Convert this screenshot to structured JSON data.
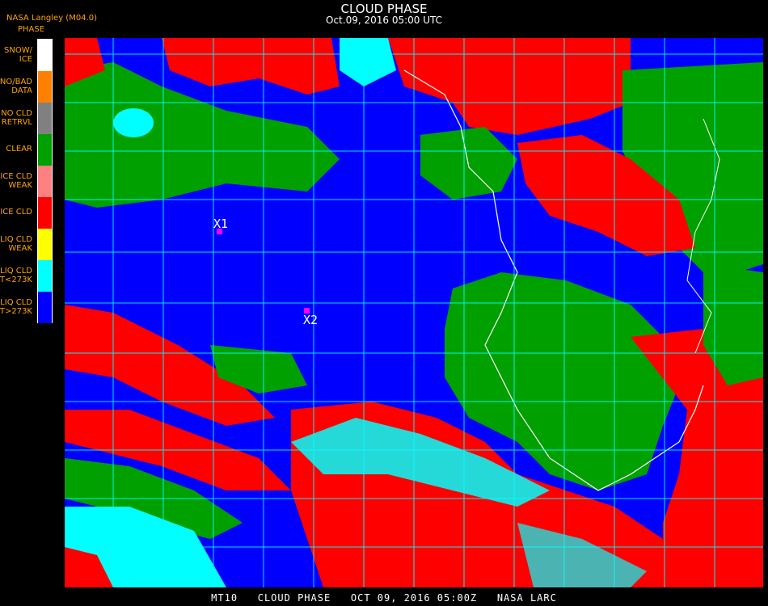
{
  "header": {
    "title": "CLOUD PHASE",
    "subtitle": "Oct.09, 2016 05:00 UTC",
    "provider": "NASA Langley (M04.0)"
  },
  "legend": {
    "title": "PHASE",
    "items": [
      {
        "label": "SNOW/\nICE",
        "color": "#ffffff"
      },
      {
        "label": "NO/BAD\nDATA",
        "color": "#ff8000"
      },
      {
        "label": "NO CLD\nRETRVL",
        "color": "#808080"
      },
      {
        "label": "CLEAR",
        "color": "#00a000"
      },
      {
        "label": "ICE CLD\nWEAK",
        "color": "#ff8080"
      },
      {
        "label": "ICE CLD",
        "color": "#ff0000"
      },
      {
        "label": "LIQ CLD\nWEAK",
        "color": "#ffff00"
      },
      {
        "label": "LIQ CLD\nT<273K",
        "color": "#00ffff"
      },
      {
        "label": "LIQ CLD\nT>273K",
        "color": "#0000ff"
      }
    ]
  },
  "markers": [
    {
      "label": "X1"
    },
    {
      "label": "X2"
    }
  ],
  "footer": "MT10   CLOUD PHASE   OCT 09, 2016 05:00Z   NASA LARC",
  "colors": {
    "grid": "#00ffff",
    "coastline": "#ffffff",
    "marker": "#ff00ff",
    "legend_text": "#ffa500"
  }
}
